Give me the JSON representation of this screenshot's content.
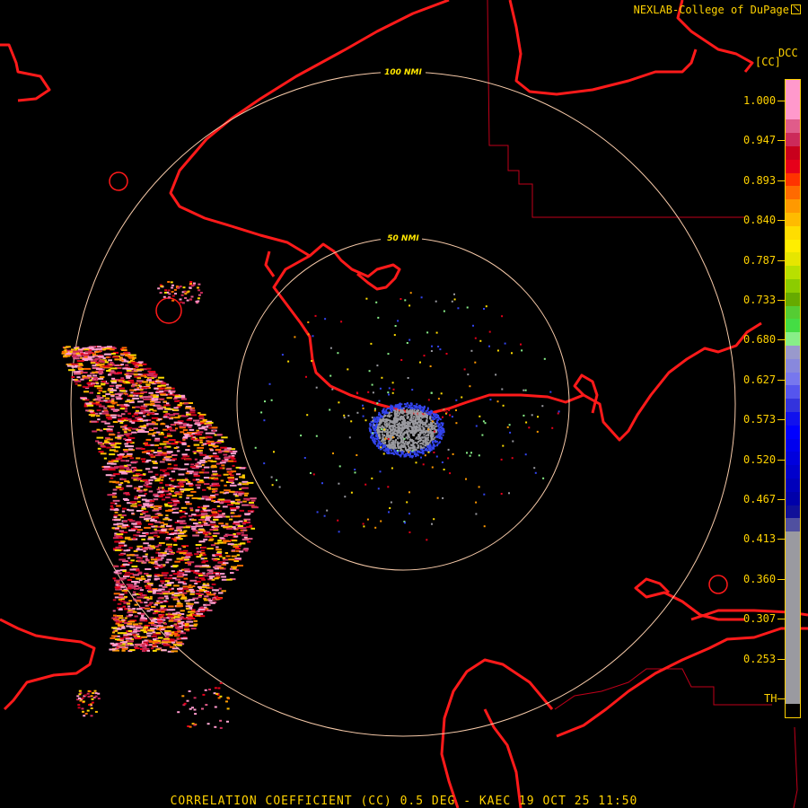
{
  "header": {
    "credit": "NEXLAB-College of DuPage",
    "credit_icon": "external-link-icon"
  },
  "map": {
    "type": "radar correlation coefficient map",
    "range_rings": [
      {
        "label": "50 NMI"
      },
      {
        "label": "100 NMI"
      }
    ],
    "colors": {
      "coastline": "#ff1a1a",
      "county_border": "#c0001a",
      "range_ring": "#f6c9a8",
      "text": "#ffd200",
      "ground_clutter": "#9a9aa0"
    }
  },
  "legend": {
    "title": "DCC",
    "unit": "[CC]",
    "ticks": [
      "1.000",
      "0.947",
      "0.893",
      "0.840",
      "0.787",
      "0.733",
      "0.680",
      "0.627",
      "0.573",
      "0.520",
      "0.467",
      "0.413",
      "0.360",
      "0.307",
      "0.253",
      "TH"
    ],
    "colors": [
      "#ff99cc",
      "#ff99cc",
      "#ff99cc",
      "#e05c8a",
      "#cc2a5a",
      "#c8001c",
      "#e6001a",
      "#ff3300",
      "#ff6a00",
      "#ff9900",
      "#ffbb00",
      "#ffdd00",
      "#ffee00",
      "#e6e600",
      "#b8e000",
      "#8ccc00",
      "#66aa00",
      "#55cc33",
      "#44dd44",
      "#88ee88",
      "#9999cc",
      "#8888dd",
      "#7777ee",
      "#5555ee",
      "#3333dd",
      "#1111ee",
      "#0000ff",
      "#0000ee",
      "#0000dd",
      "#0000cc",
      "#0000bb",
      "#0000aa",
      "#101099",
      "#5050a0",
      "#9a9aa0",
      "#9a9aa0",
      "#9a9aa0",
      "#9a9aa0",
      "#9a9aa0",
      "#9a9aa0",
      "#9a9aa0",
      "#9a9aa0",
      "#9a9aa0",
      "#9a9aa0",
      "#9a9aa0",
      "#9a9aa0",
      "#9a9aa0",
      "#000000"
    ]
  },
  "footer": {
    "title": "CORRELATION COEFFICIENT (CC) 0.5 DEG - KAEC 19 OCT 25 11:50"
  }
}
